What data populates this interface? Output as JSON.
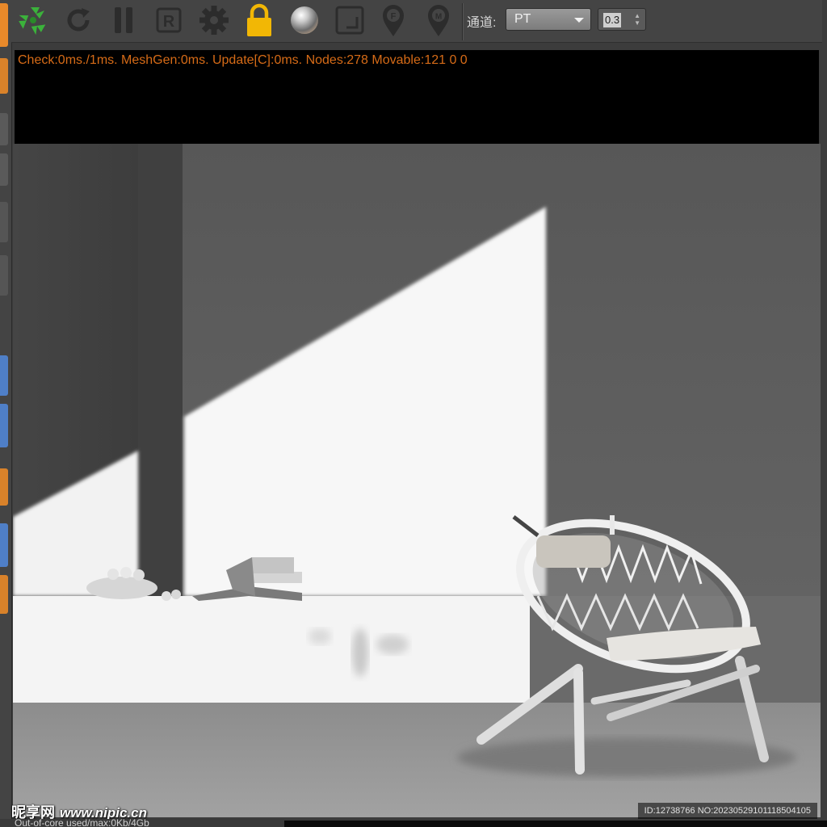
{
  "toolbar": {
    "buttons": [
      {
        "id": "start-render",
        "icon": "green-recycle-star-icon",
        "color": "#3bb23b"
      },
      {
        "id": "refresh",
        "icon": "refresh-icon"
      },
      {
        "id": "pause",
        "icon": "pause-icon"
      },
      {
        "id": "reset",
        "icon": "r-box-icon",
        "glyph": "R"
      },
      {
        "id": "settings",
        "icon": "gear-icon"
      },
      {
        "id": "lock",
        "icon": "lock-icon",
        "color": "#f2b705"
      },
      {
        "id": "material",
        "icon": "glass-sphere-icon"
      },
      {
        "id": "region",
        "icon": "region-box-icon"
      },
      {
        "id": "focus-pick",
        "icon": "pin-f-icon",
        "glyph": "F"
      },
      {
        "id": "material-pick",
        "icon": "pin-m-icon",
        "glyph": "M"
      }
    ],
    "channel_label": "通道:",
    "channel_value": "PT",
    "spinner_value": "0.3"
  },
  "log": {
    "line": "Check:0ms./1ms. MeshGen:0ms. Update[C]:0ms. Nodes:278 Movable:121  0 0",
    "text_color": "#d66b17"
  },
  "viewport": {
    "scene": "rendered interior: sunlit wall, marble bench with books and bowl, woven hoop chair"
  },
  "watermark": {
    "logo_text": "昵享网",
    "url": "www.nipic.cn",
    "id_text": "ID:12738766 NO:20230529101118504105"
  },
  "status_bar": {
    "text": "Out-of-core used/max:0Kb/4Gb"
  },
  "colors": {
    "toolbar_bg": "#444444",
    "accent_orange": "#e8892a",
    "accent_blue": "#4f7fc7"
  }
}
